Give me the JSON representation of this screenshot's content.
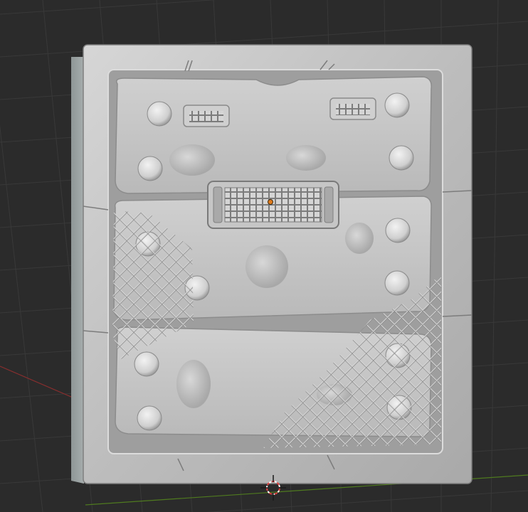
{
  "app": {
    "name": "3D viewport",
    "background": "#2b2b2b",
    "grid_color": "#3a3a3a",
    "x_axis_color": "#b23a3a",
    "y_axis_color": "#6c9a2a"
  },
  "viewport": {
    "object": {
      "description_icon": "sculpted-wall-panel-icon",
      "panels": 3,
      "bolts_per_panel": 4,
      "vents": 3,
      "mesh_patches": 2,
      "base_color": "#c9c9c9",
      "shadow_color": "#8a8a8a",
      "highlight_color": "#e9e9e9"
    },
    "origin_marker": {
      "icon": "object-origin-icon",
      "color": "#e07b1c"
    },
    "cursor_3d": {
      "icon": "3d-cursor-icon",
      "color": "#e04040"
    }
  }
}
